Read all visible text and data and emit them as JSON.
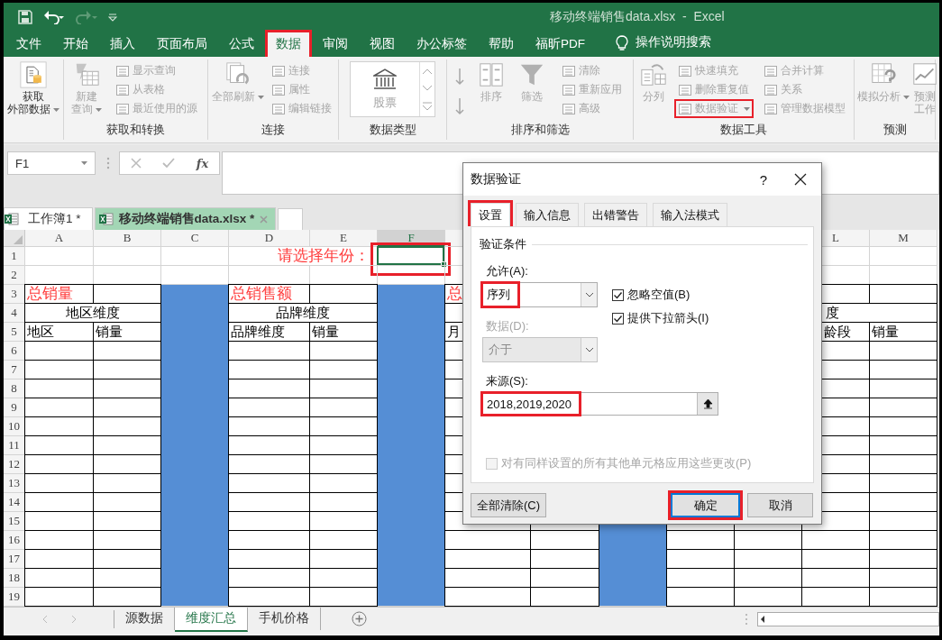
{
  "window": {
    "title": "移动终端销售data.xlsx  -  Excel"
  },
  "ribbon_tabs": [
    {
      "label": "文件",
      "selected": false,
      "highlighted": false
    },
    {
      "label": "开始",
      "selected": false,
      "highlighted": false
    },
    {
      "label": "插入",
      "selected": false,
      "highlighted": false
    },
    {
      "label": "页面布局",
      "selected": false,
      "highlighted": false
    },
    {
      "label": "公式",
      "selected": false,
      "highlighted": false
    },
    {
      "label": "数据",
      "selected": true,
      "highlighted": true
    },
    {
      "label": "审阅",
      "selected": false,
      "highlighted": false
    },
    {
      "label": "视图",
      "selected": false,
      "highlighted": false
    },
    {
      "label": "办公标签",
      "selected": false,
      "highlighted": false
    },
    {
      "label": "帮助",
      "selected": false,
      "highlighted": false
    },
    {
      "label": "福昕PDF",
      "selected": false,
      "highlighted": false
    }
  ],
  "tell_me": "操作说明搜索",
  "ribbon": {
    "groups": [
      {
        "items": [
          {
            "label": [
              "获取",
              "外部数据"
            ],
            "kind": "large",
            "disabled": false,
            "dropdown": true
          }
        ]
      },
      {
        "label": "获取和转换",
        "items": [
          {
            "label": [
              "新建",
              "查询"
            ],
            "kind": "large",
            "disabled": true,
            "dropdown": true
          },
          {
            "label": "显示查询",
            "kind": "small",
            "disabled": true
          },
          {
            "label": "从表格",
            "kind": "small",
            "disabled": true
          },
          {
            "label": "最近使用的源",
            "kind": "small",
            "disabled": true
          }
        ]
      },
      {
        "label": "连接",
        "items": [
          {
            "label": [
              "全部刷新"
            ],
            "kind": "large",
            "disabled": true,
            "dropdown": true
          },
          {
            "label": "连接",
            "kind": "small",
            "disabled": true
          },
          {
            "label": "属性",
            "kind": "small",
            "disabled": true
          },
          {
            "label": "编辑链接",
            "kind": "small",
            "disabled": true
          }
        ]
      },
      {
        "label": "数据类型",
        "items": [
          {
            "label": "股票",
            "kind": "gallery",
            "disabled": true
          }
        ]
      },
      {
        "label": "排序和筛选",
        "items": [
          {
            "kind": "sort_pair",
            "disabled": true
          },
          {
            "label": [
              "排序"
            ],
            "kind": "large",
            "disabled": true
          },
          {
            "label": [
              "筛选"
            ],
            "kind": "large",
            "disabled": true
          },
          {
            "label": "清除",
            "kind": "small",
            "disabled": true
          },
          {
            "label": "重新应用",
            "kind": "small",
            "disabled": true
          },
          {
            "label": "高级",
            "kind": "small",
            "disabled": true
          }
        ]
      },
      {
        "label": "数据工具",
        "items": [
          {
            "label": [
              "分列"
            ],
            "kind": "large",
            "disabled": true
          },
          {
            "label": "快速填充",
            "kind": "small",
            "disabled": true
          },
          {
            "label": "删除重复值",
            "kind": "small",
            "disabled": true
          },
          {
            "label": "数据验证",
            "kind": "small",
            "disabled": true,
            "dropdown": true,
            "highlighted": true
          },
          {
            "label": "合并计算",
            "kind": "small",
            "disabled": true
          },
          {
            "label": "关系",
            "kind": "small",
            "disabled": true
          },
          {
            "label": "管理数据模型",
            "kind": "small",
            "disabled": true
          }
        ]
      },
      {
        "label": "预测",
        "items": [
          {
            "label": [
              "模拟分析"
            ],
            "kind": "large",
            "disabled": true,
            "dropdown": true
          },
          {
            "label": [
              "预测",
              "工作"
            ],
            "kind": "large",
            "disabled": true
          }
        ]
      }
    ]
  },
  "formula_bar": {
    "name_box": "F1",
    "function_label": "fx"
  },
  "workbook_tabs": [
    {
      "label": "工作簿1 *",
      "selected": false
    },
    {
      "label": "移动终端销售data.xlsx *",
      "selected": true
    }
  ],
  "sheet": {
    "columns": [
      {
        "label": "A"
      },
      {
        "label": "B"
      },
      {
        "label": "C",
        "color": "#558ed5"
      },
      {
        "label": "D"
      },
      {
        "label": "E"
      },
      {
        "label": "F",
        "color": "#558ed5"
      },
      {},
      {},
      {
        "color": "#558ed5"
      },
      {},
      {},
      {
        "label": "L"
      },
      {
        "label": "M"
      }
    ],
    "rows": [
      "1",
      "2",
      "3",
      "4",
      "5",
      "6",
      "7",
      "8",
      "9",
      "10",
      "11",
      "12",
      "13",
      "14",
      "15",
      "16",
      "17",
      "18",
      "19"
    ],
    "prompt": {
      "label": "请选择年份：",
      "input_selected": true,
      "highlighted": true
    },
    "blocks": [
      {
        "title": "总销量",
        "group": "地区维度",
        "headers": [
          "地区",
          "销量"
        ],
        "covered_left": false
      },
      {
        "title": "总销售额",
        "group": "品牌维度",
        "headers": [
          "品牌维度",
          "销量"
        ],
        "covered_left": false
      },
      {
        "title": "总",
        "headers": [
          "月"
        ],
        "covered_left": false
      },
      {
        "group": "度",
        "headers": [
          "龄段",
          "销量"
        ],
        "covered_left": true
      }
    ]
  },
  "dialog": {
    "title": "数据验证",
    "help": "?",
    "tabs": [
      {
        "label": "设置",
        "selected": true,
        "highlighted": true
      },
      {
        "label": "输入信息",
        "selected": false,
        "highlighted": false
      },
      {
        "label": "出错警告",
        "selected": false,
        "highlighted": false
      },
      {
        "label": "输入法模式",
        "selected": false,
        "highlighted": false
      }
    ],
    "section": "验证条件",
    "allow": {
      "label": "允许(A):",
      "value": "序列",
      "highlighted": true
    },
    "options": [
      {
        "label": "忽略空值(B)",
        "checked": true
      },
      {
        "label": "提供下拉箭头(I)",
        "checked": true
      }
    ],
    "data": {
      "label": "数据(D):",
      "value": "介于",
      "disabled": true
    },
    "source": {
      "label": "来源(S):",
      "value": "2018,2019,2020",
      "highlighted": true
    },
    "apply_all": {
      "label": "对有同样设置的所有其他单元格应用这些更改(P)",
      "checked": false,
      "disabled": true
    },
    "buttons": [
      {
        "label": "全部清除(C)",
        "kind": "clear",
        "highlighted": false
      },
      {
        "label": "确定",
        "kind": "ok",
        "highlighted": true
      },
      {
        "label": "取消",
        "kind": "cancel",
        "highlighted": false
      }
    ]
  },
  "sheet_tabs": [
    {
      "label": "源数据",
      "selected": false
    },
    {
      "label": "维度汇总",
      "selected": true
    },
    {
      "label": "手机价格",
      "selected": false
    }
  ]
}
